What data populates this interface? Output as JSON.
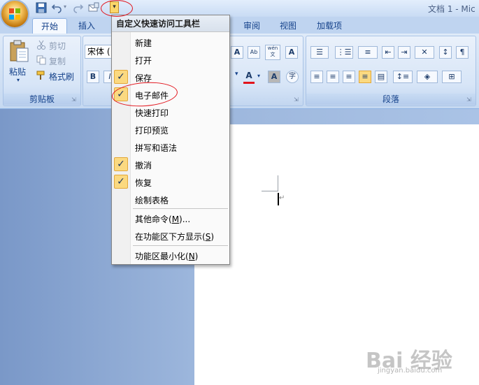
{
  "window": {
    "title": "文档 1 - Mic"
  },
  "tabs": [
    {
      "label": "开始",
      "active": true
    },
    {
      "label": "插入"
    },
    {
      "label": "审阅"
    },
    {
      "label": "视图"
    },
    {
      "label": "加载项"
    }
  ],
  "clipboard": {
    "paste": "粘贴",
    "cut": "剪切",
    "copy": "复制",
    "format_painter": "格式刷",
    "group_label": "剪贴板"
  },
  "font": {
    "name_value": "宋体 (",
    "bold": "B",
    "italic": "I",
    "font_color_glyph": "A",
    "char_shade_glyph": "A",
    "enclose_glyph": "字",
    "phonetic_glyph": "wén",
    "grow_glyph": "A"
  },
  "paragraph": {
    "group_label": "段落"
  },
  "menu": {
    "header": "自定义快速访问工具栏",
    "items": [
      {
        "label": "新建",
        "checked": false
      },
      {
        "label": "打开",
        "checked": false
      },
      {
        "label": "保存",
        "checked": true
      },
      {
        "label": "电子邮件",
        "checked": true
      },
      {
        "label": "快速打印",
        "checked": false
      },
      {
        "label": "打印预览",
        "checked": false
      },
      {
        "label": "拼写和语法",
        "checked": false
      },
      {
        "label": "撤消",
        "checked": true
      },
      {
        "label": "恢复",
        "checked": true
      },
      {
        "label": "绘制表格",
        "checked": false
      }
    ],
    "more_commands": {
      "text": "其他命令(",
      "key": "M",
      "suffix": ")..."
    },
    "show_below": {
      "text": "在功能区下方显示(",
      "key": "S",
      "suffix": ")"
    },
    "minimize": {
      "text": "功能区最小化(",
      "key": "N",
      "suffix": ")"
    },
    "check_glyph": "✓"
  },
  "watermark": {
    "main": "Bai 经验",
    "sub": "jingyan.baidu.com"
  },
  "colors": {
    "accent": "#15428b",
    "check_bg": "#fbd980",
    "annotation": "#e2141c"
  }
}
